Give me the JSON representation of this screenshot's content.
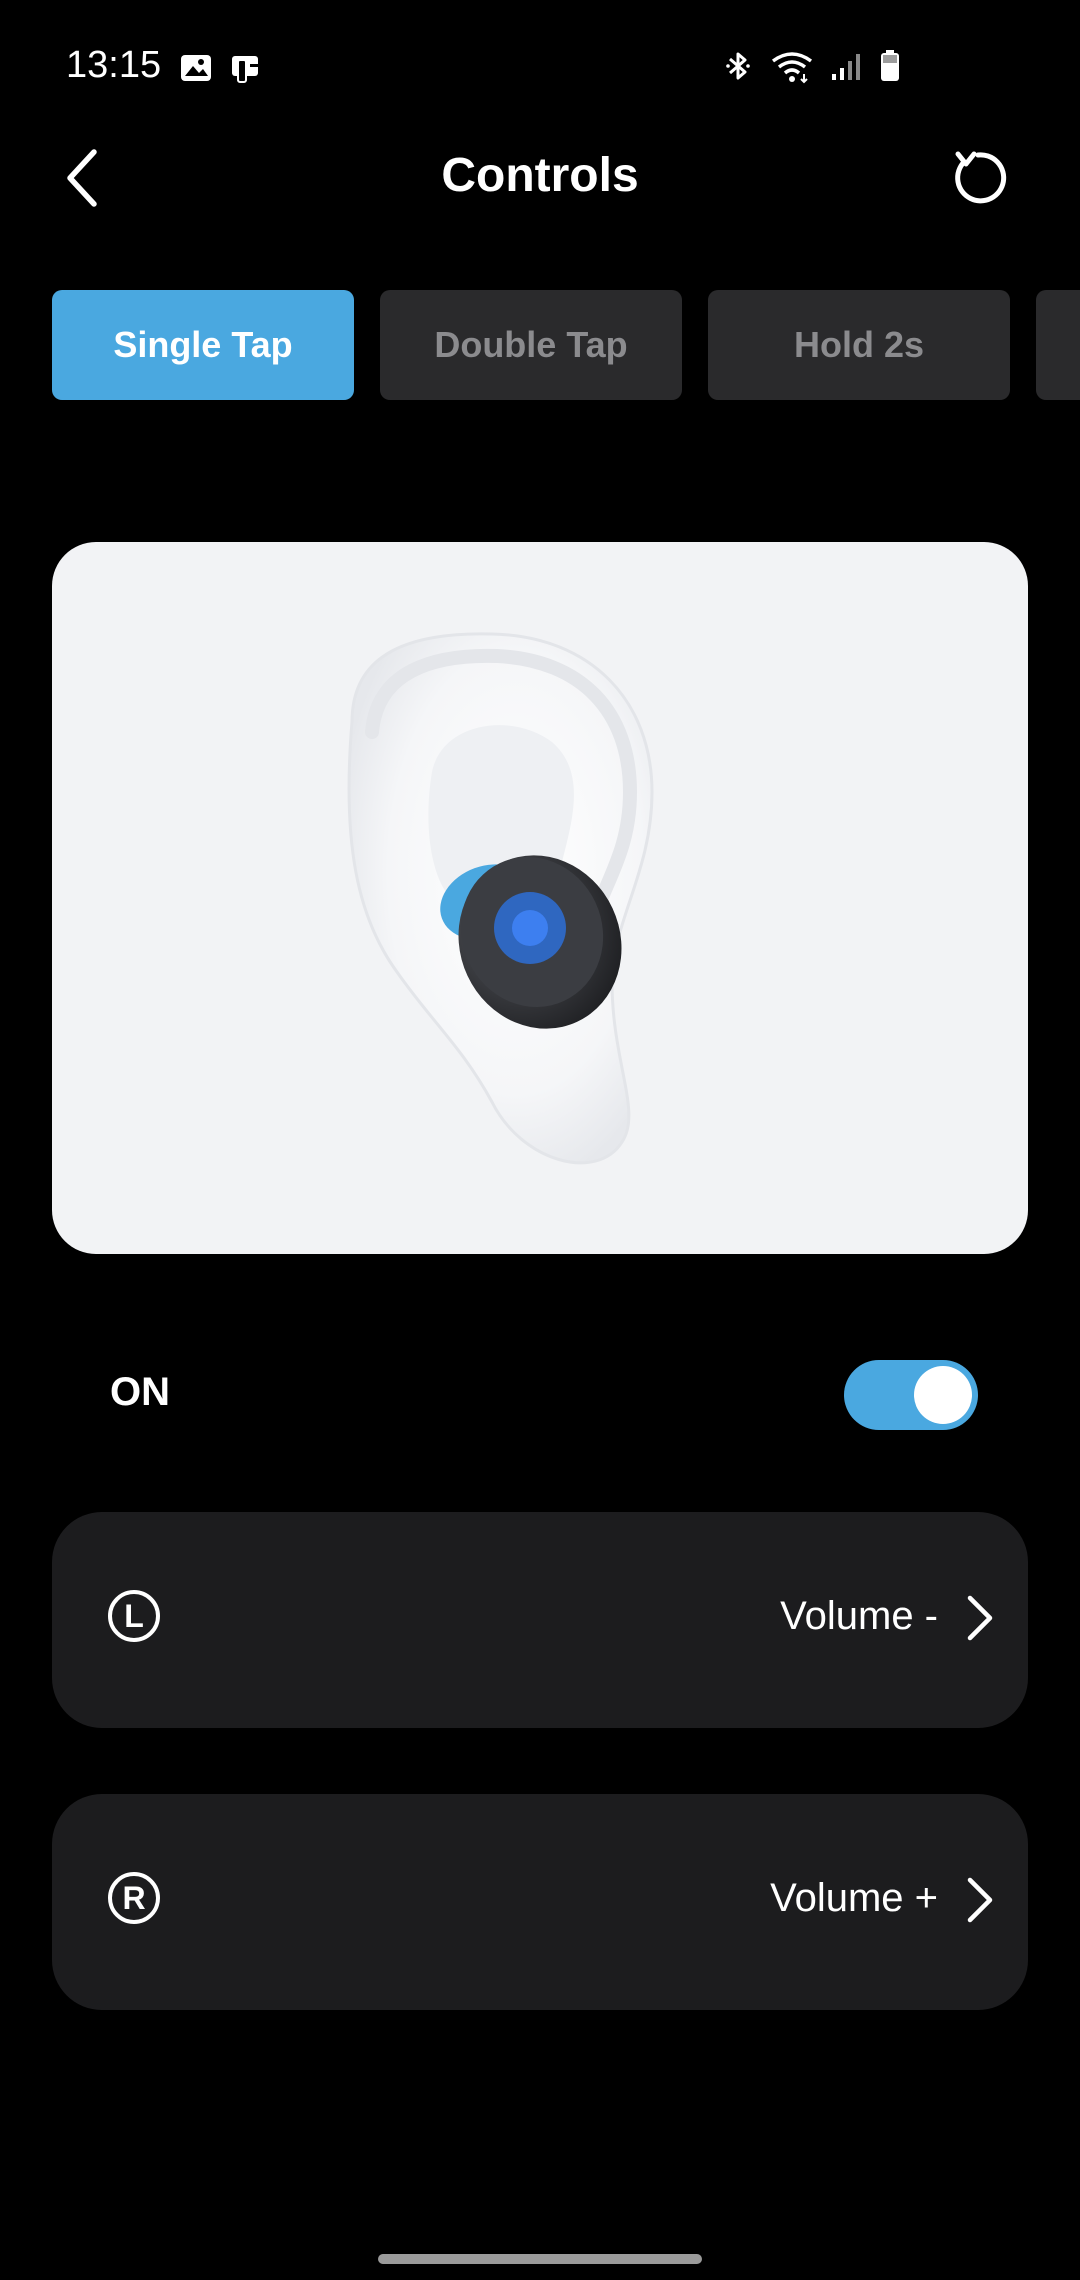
{
  "status_bar": {
    "time": "13:15",
    "left_icons": [
      "gallery-icon",
      "device-icon"
    ],
    "right_icons": [
      "bluetooth-icon",
      "wifi-icon",
      "signal-icon",
      "battery-icon"
    ]
  },
  "header": {
    "title": "Controls",
    "back_icon": "chevron-left-icon",
    "reset_icon": "reset-icon"
  },
  "tabs": [
    {
      "label": "Single Tap",
      "active": true
    },
    {
      "label": "Double Tap",
      "active": false
    },
    {
      "label": "Hold 2s",
      "active": false
    },
    {
      "label": "",
      "active": false
    }
  ],
  "illustration": {
    "subject": "ear-with-earbud",
    "accent_color": "#4aa8e0"
  },
  "toggle": {
    "label": "ON",
    "state": true,
    "color": "#4aa8e0"
  },
  "sides": [
    {
      "badge": "L",
      "value": "Volume -"
    },
    {
      "badge": "R",
      "value": "Volume +"
    }
  ],
  "colors": {
    "accent": "#4aa8e0",
    "background": "#000000",
    "card": "#1c1c1e",
    "tab_inactive": "#2a2a2c"
  }
}
